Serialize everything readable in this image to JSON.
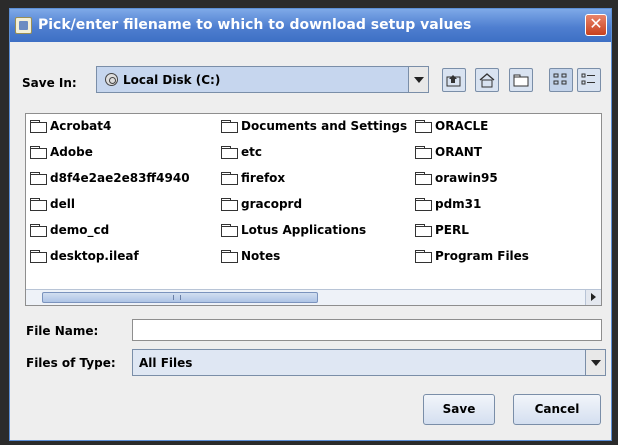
{
  "window": {
    "title": "Pick/enter filename to which to download setup values",
    "close_glyph": "✕"
  },
  "save_in": {
    "label": "Save In:",
    "value": "Local Disk (C:)",
    "icon": "disk-icon"
  },
  "toolbar": {
    "icons": [
      "up-one-level-icon",
      "home-icon",
      "new-folder-icon",
      "list-view-icon",
      "details-view-icon"
    ]
  },
  "files": [
    [
      "Acrobat4",
      "Adobe",
      "d8f4e2ae2e83ff4940",
      "dell",
      "demo_cd",
      "desktop.ileaf"
    ],
    [
      "Documents and Settings",
      "etc",
      "firefox",
      "gracoprd",
      "Lotus Applications",
      "Notes"
    ],
    [
      "ORACLE",
      "ORANT",
      "orawin95",
      "pdm31",
      "PERL",
      "Program Files"
    ]
  ],
  "file_name": {
    "label": "File Name:",
    "value": "",
    "placeholder": ""
  },
  "files_of_type": {
    "label": "Files of Type:",
    "value": "All Files"
  },
  "buttons": {
    "save": "Save",
    "cancel": "Cancel"
  },
  "colors": {
    "title_bar": "#4f7fd0",
    "combo_bg": "#c6d6ee",
    "close_button": "#c8411f"
  }
}
